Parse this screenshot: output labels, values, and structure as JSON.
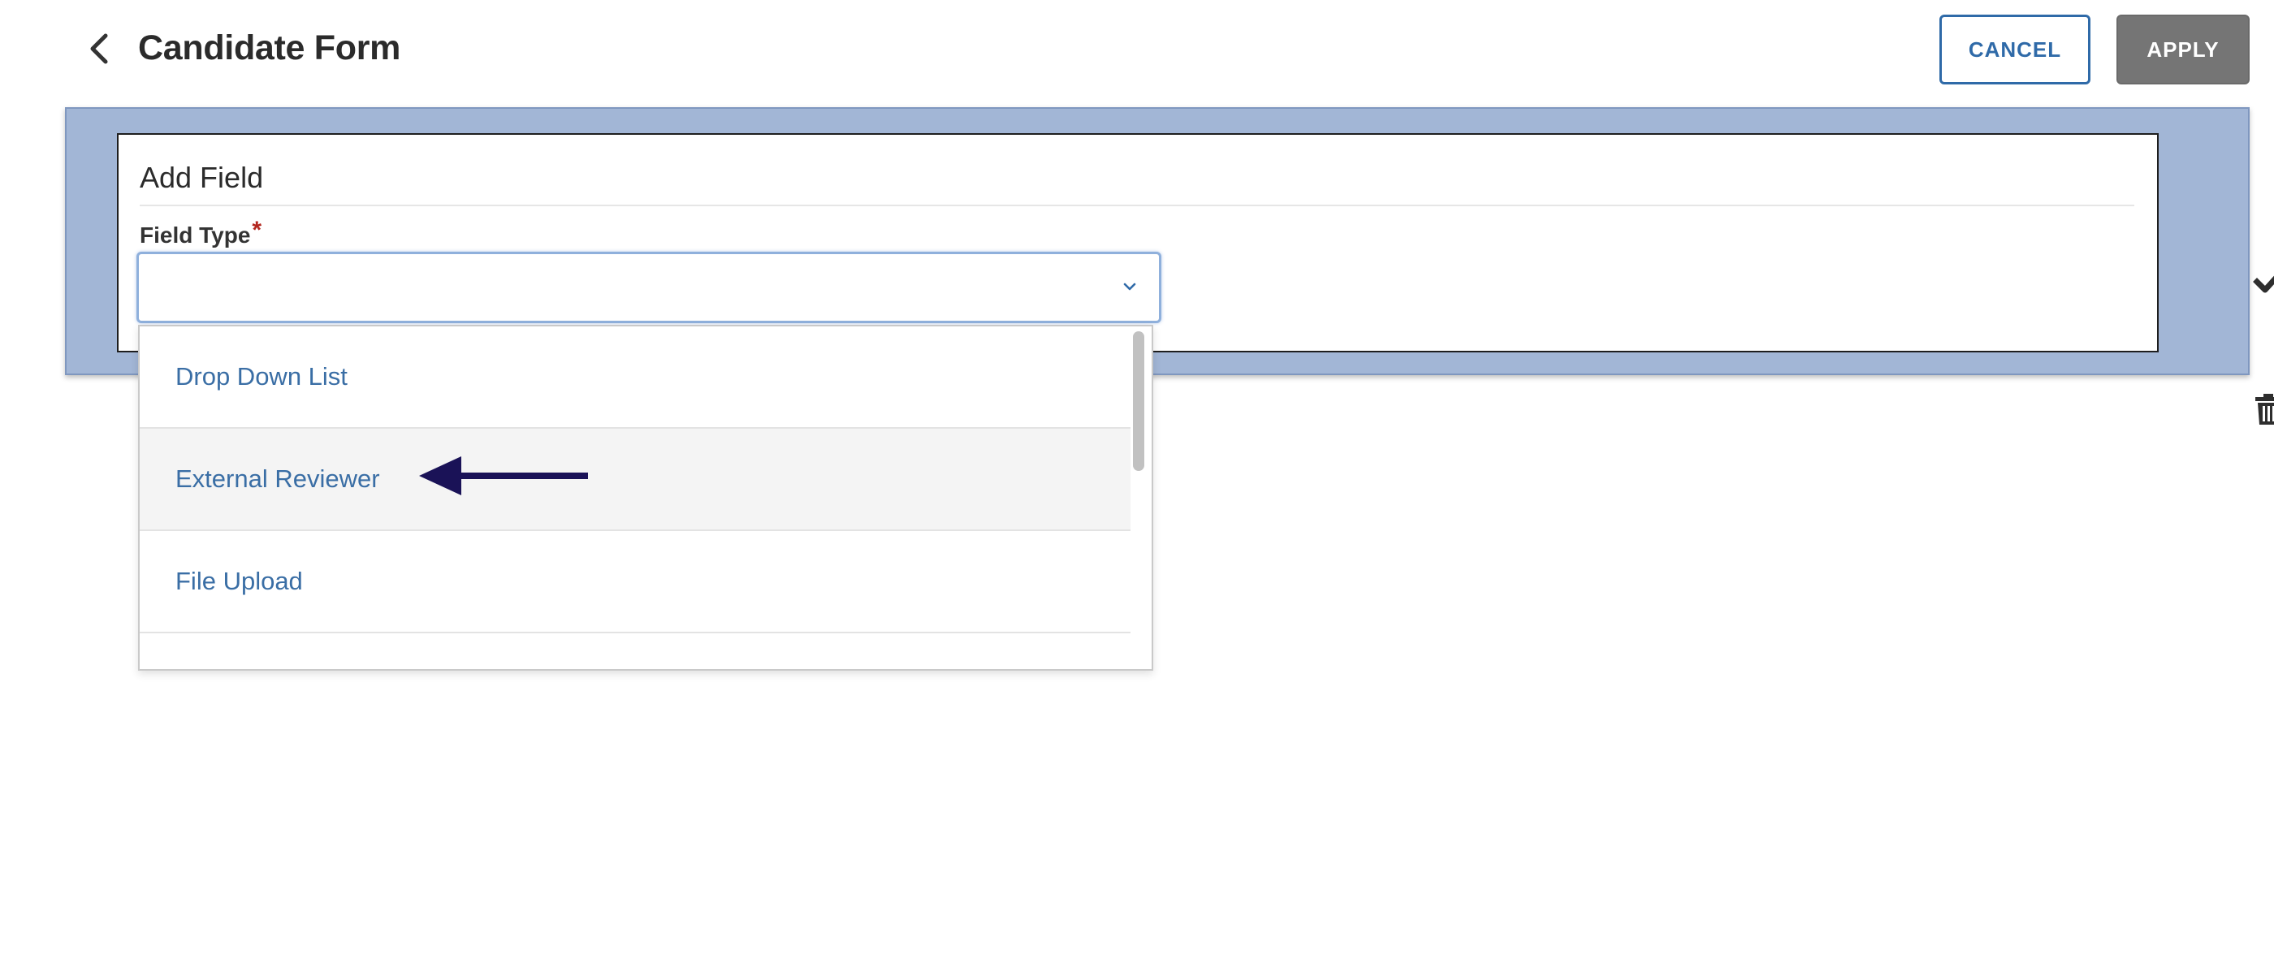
{
  "header": {
    "title": "Candidate Form",
    "back_icon": "chevron-left-icon",
    "cancel_label": "CANCEL",
    "apply_label": "APPLY"
  },
  "field_panel": {
    "card_title": "Add Field",
    "field_type_label": "Field Type",
    "required_marker": "*",
    "select_value": "",
    "select_icon": "chevron-down-icon",
    "actions": {
      "save_icon": "check-icon",
      "delete_icon": "trash-icon"
    }
  },
  "dropdown": {
    "options": [
      {
        "label": "Drop Down List",
        "highlighted": false
      },
      {
        "label": "External Reviewer",
        "highlighted": true
      },
      {
        "label": "File Upload",
        "highlighted": false
      },
      {
        "label": "",
        "highlighted": false
      }
    ]
  },
  "annotation": {
    "icon": "arrow-left-icon",
    "color": "#1a1257"
  },
  "colors": {
    "accent_blue": "#2f6aa8",
    "panel_bg": "#a2b6d6",
    "apply_bg": "#757575",
    "option_text": "#3a6ea5",
    "required": "#b3261e"
  }
}
